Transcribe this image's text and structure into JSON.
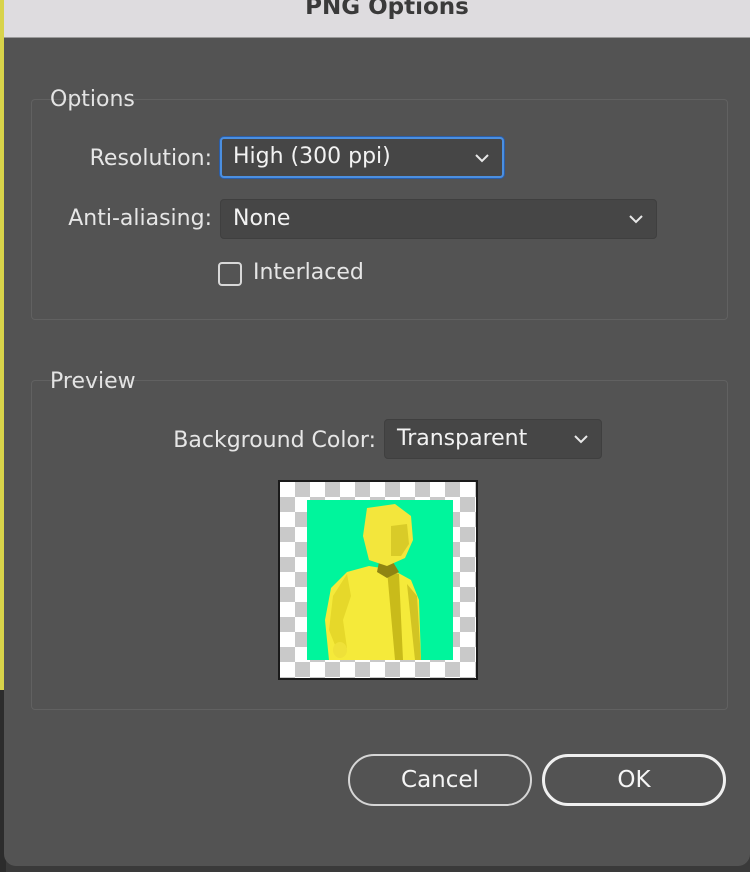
{
  "window": {
    "title": "PNG Options"
  },
  "options_group": {
    "label": "Options",
    "resolution": {
      "label": "Resolution:",
      "value": "High (300 ppi)"
    },
    "antialiasing": {
      "label": "Anti-aliasing:",
      "value": "None"
    },
    "interlaced": {
      "label": "Interlaced",
      "checked": false
    }
  },
  "preview_group": {
    "label": "Preview",
    "background_color": {
      "label": "Background Color:",
      "value": "Transparent"
    }
  },
  "buttons": {
    "cancel": "Cancel",
    "ok": "OK"
  },
  "icons": {
    "dropdown": "chevron-down-icon"
  },
  "colors": {
    "accent": "#4b8fe0",
    "preview_bg": "#00f59c",
    "preview_figure": "#f5ea3a"
  }
}
